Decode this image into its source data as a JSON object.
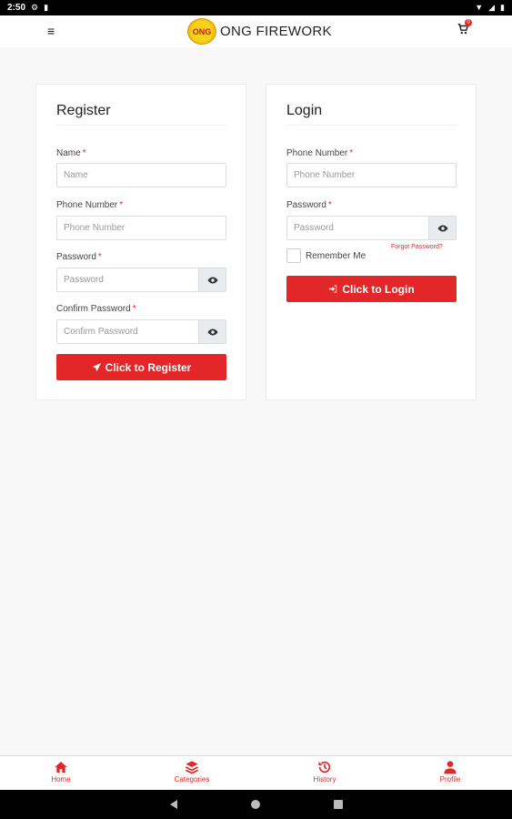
{
  "status_bar": {
    "time": "2:50"
  },
  "header": {
    "brand": "ONG FIREWORK",
    "logo_text": "ONG",
    "cart_count": "0"
  },
  "register": {
    "title": "Register",
    "name_label": "Name",
    "name_placeholder": "Name",
    "phone_label": "Phone Number",
    "phone_placeholder": "Phone Number",
    "password_label": "Password",
    "password_placeholder": "Password",
    "confirm_label": "Confirm Password",
    "confirm_placeholder": "Confirm Password",
    "required_mark": "*",
    "submit_label": "Click to Register"
  },
  "login": {
    "title": "Login",
    "phone_label": "Phone Number",
    "phone_placeholder": "Phone Number",
    "password_label": "Password",
    "password_placeholder": "Password",
    "required_mark": "*",
    "remember_label": "Remember Me",
    "forgot_label": "Forgot Password?",
    "submit_label": "Click to Login"
  },
  "bottom_nav": {
    "items": [
      {
        "label": "Home",
        "icon": "home-icon"
      },
      {
        "label": "Categories",
        "icon": "layers-icon"
      },
      {
        "label": "History",
        "icon": "history-icon"
      },
      {
        "label": "Profile",
        "icon": "user-icon"
      }
    ]
  },
  "colors": {
    "accent": "#e32627",
    "background": "#f8f8f8"
  }
}
